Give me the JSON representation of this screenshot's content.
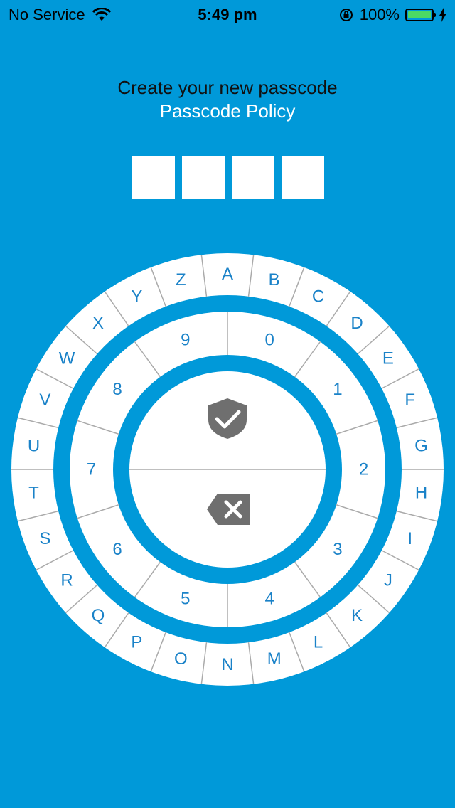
{
  "status_bar": {
    "carrier": "No Service",
    "time": "5:49 pm",
    "battery": "100%"
  },
  "header": {
    "title": "Create your new passcode",
    "subtitle": "Passcode Policy"
  },
  "passcode": {
    "length": 4
  },
  "dial": {
    "outer_letters": [
      "A",
      "B",
      "C",
      "D",
      "E",
      "F",
      "G",
      "H",
      "I",
      "J",
      "K",
      "L",
      "M",
      "N",
      "O",
      "P",
      "Q",
      "R",
      "S",
      "T",
      "U",
      "V",
      "W",
      "X",
      "Y",
      "Z"
    ],
    "inner_digits": [
      "0",
      "1",
      "2",
      "3",
      "4",
      "5",
      "6",
      "7",
      "8",
      "9"
    ],
    "center": {
      "top_icon": "shield-check-icon",
      "bottom_icon": "backspace-icon"
    }
  },
  "colors": {
    "background": "#0099d9",
    "key_text": "#1a82c8",
    "icon": "#6f6f6f"
  }
}
